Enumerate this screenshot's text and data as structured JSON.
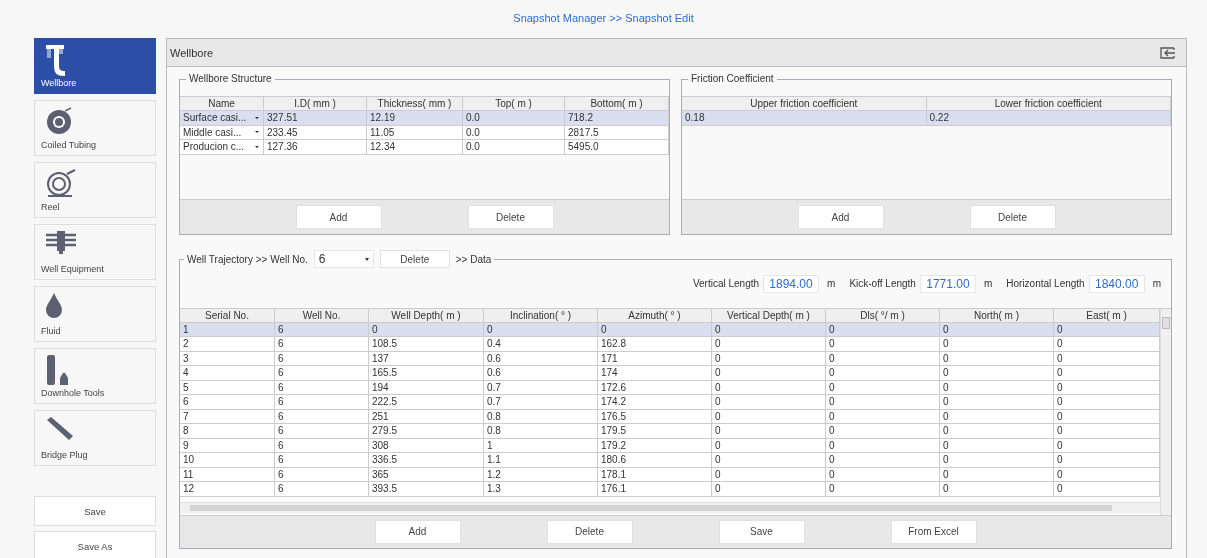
{
  "header": {
    "title": "Snapshot Manager >> Snapshot Edit"
  },
  "sidebar": {
    "items": [
      {
        "label": "Wellbore",
        "kind": "wellbore",
        "selected": true
      },
      {
        "label": "Coiled Tubing",
        "kind": "coil",
        "selected": false
      },
      {
        "label": "Reel",
        "kind": "reel",
        "selected": false
      },
      {
        "label": "Well Equipment",
        "kind": "equipment",
        "selected": false
      },
      {
        "label": "Fluid",
        "kind": "fluid",
        "selected": false
      },
      {
        "label": "Downhole Tools",
        "kind": "tools",
        "selected": false
      },
      {
        "label": "Bridge Plug",
        "kind": "plug",
        "selected": false
      }
    ],
    "buttons": [
      "Save",
      "Save As"
    ]
  },
  "panel": {
    "title": "Wellbore"
  },
  "wellbore_structure": {
    "title": "Wellbore Structure",
    "columns": [
      "Name",
      "I.D( mm )",
      "Thickness( mm )",
      "Top( m )",
      "Bottom( m )"
    ],
    "rows": [
      {
        "selected": true,
        "cells": [
          "Surface casi...",
          "327.51",
          "12.19",
          "0.0",
          "718.2"
        ]
      },
      {
        "selected": false,
        "cells": [
          "Middle casi...",
          "233.45",
          "11.05",
          "0.0",
          "2817.5"
        ]
      },
      {
        "selected": false,
        "cells": [
          "Producion c...",
          "127.36",
          "12.34",
          "0.0",
          "5495.0"
        ]
      }
    ],
    "buttons": [
      "Add",
      "Delete"
    ]
  },
  "friction": {
    "title": "Friction Coefficient",
    "columns": [
      "Upper friction coefficient",
      "Lower friction coefficient"
    ],
    "rows": [
      {
        "selected": true,
        "cells": [
          "0.18",
          "0.22"
        ]
      }
    ],
    "buttons": [
      "Add",
      "Delete"
    ]
  },
  "trajectory": {
    "title": "Well Trajectory >> Well No.",
    "well_no": "6",
    "delete_button": "Delete",
    "data_label": ">> Data",
    "lengths": [
      {
        "label": "Vertical Length",
        "value": "1894.00",
        "unit": "m"
      },
      {
        "label": "Kick-off Length",
        "value": "1771.00",
        "unit": "m"
      },
      {
        "label": "Horizontal Length",
        "value": "1840.00",
        "unit": "m"
      }
    ],
    "columns": [
      "Serial No.",
      "Well No.",
      "Well Depth( m )",
      "Inclination( ° )",
      "Azimuth( ° )",
      "Vertical Depth( m )",
      "Dls( °/ m )",
      "North( m )",
      "East( m )"
    ],
    "rows": [
      {
        "selected": true,
        "cells": [
          "1",
          "6",
          "0",
          "0",
          "0",
          "0",
          "0",
          "0",
          "0"
        ]
      },
      {
        "selected": false,
        "cells": [
          "2",
          "6",
          "108.5",
          "0.4",
          "162.8",
          "0",
          "0",
          "0",
          "0"
        ]
      },
      {
        "selected": false,
        "cells": [
          "3",
          "6",
          "137",
          "0.6",
          "171",
          "0",
          "0",
          "0",
          "0"
        ]
      },
      {
        "selected": false,
        "cells": [
          "4",
          "6",
          "165.5",
          "0.6",
          "174",
          "0",
          "0",
          "0",
          "0"
        ]
      },
      {
        "selected": false,
        "cells": [
          "5",
          "6",
          "194",
          "0.7",
          "172.6",
          "0",
          "0",
          "0",
          "0"
        ]
      },
      {
        "selected": false,
        "cells": [
          "6",
          "6",
          "222.5",
          "0.7",
          "174.2",
          "0",
          "0",
          "0",
          "0"
        ]
      },
      {
        "selected": false,
        "cells": [
          "7",
          "6",
          "251",
          "0.8",
          "176.5",
          "0",
          "0",
          "0",
          "0"
        ]
      },
      {
        "selected": false,
        "cells": [
          "8",
          "6",
          "279.5",
          "0.8",
          "179.5",
          "0",
          "0",
          "0",
          "0"
        ]
      },
      {
        "selected": false,
        "cells": [
          "9",
          "6",
          "308",
          "1",
          "179.2",
          "0",
          "0",
          "0",
          "0"
        ]
      },
      {
        "selected": false,
        "cells": [
          "10",
          "6",
          "336.5",
          "1.1",
          "180.6",
          "0",
          "0",
          "0",
          "0"
        ]
      },
      {
        "selected": false,
        "cells": [
          "11",
          "6",
          "365",
          "1.2",
          "178.1",
          "0",
          "0",
          "0",
          "0"
        ]
      },
      {
        "selected": false,
        "cells": [
          "12",
          "6",
          "393.5",
          "1.3",
          "176.1",
          "0",
          "0",
          "0",
          "0"
        ]
      }
    ],
    "buttons": [
      "Add",
      "Delete",
      "Save",
      "From Excel"
    ]
  }
}
